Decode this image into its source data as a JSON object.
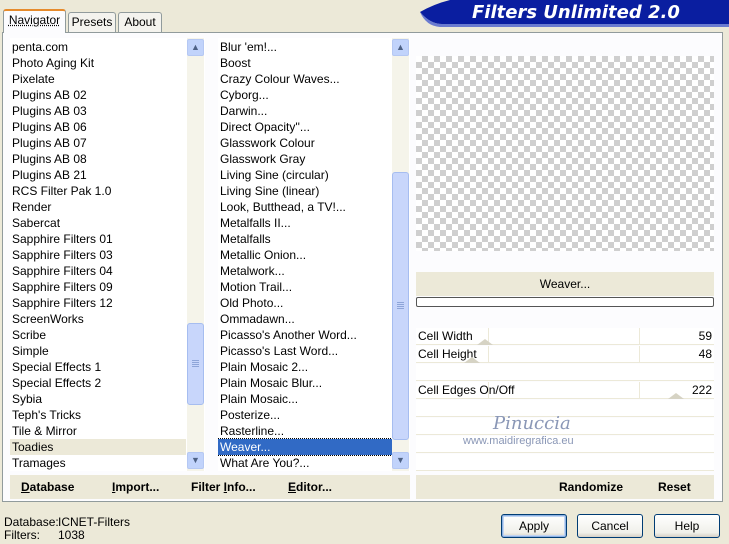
{
  "header": {
    "title": "Filters Unlimited 2.0"
  },
  "tabs": [
    {
      "label": "Navigator",
      "active": true
    },
    {
      "label": "Presets",
      "active": false
    },
    {
      "label": "About",
      "active": false
    }
  ],
  "categories": {
    "items": [
      "penta.com",
      "Photo Aging Kit",
      "Pixelate",
      "Plugins AB 02",
      "Plugins AB 03",
      "Plugins AB 06",
      "Plugins AB 07",
      "Plugins AB 08",
      "Plugins AB 21",
      "RCS Filter Pak 1.0",
      "Render",
      "Sabercat",
      "Sapphire Filters 01",
      "Sapphire Filters 03",
      "Sapphire Filters 04",
      "Sapphire Filters 09",
      "Sapphire Filters 12",
      "ScreenWorks",
      "Scribe",
      "Simple",
      "Special Effects 1",
      "Special Effects 2",
      "Sybia",
      "Teph's Tricks",
      "Tile & Mirror",
      "Toadies",
      "Tramages"
    ],
    "selected": "Toadies"
  },
  "filters": {
    "items": [
      "Blur 'em!...",
      "Boost",
      "Crazy Colour Waves...",
      "Cyborg...",
      "Darwin...",
      "Direct Opacity''...",
      "Glasswork Colour",
      "Glasswork Gray",
      "Living Sine (circular)",
      "Living Sine (linear)",
      "Look, Butthead, a TV!...",
      "Metalfalls II...",
      "Metalfalls",
      "Metallic Onion...",
      "Metalwork...",
      "Motion Trail...",
      "Old Photo...",
      "Ommadawn...",
      "Picasso's Another Word...",
      "Picasso's Last Word...",
      "Plain Mosaic 2...",
      "Plain Mosaic Blur...",
      "Plain Mosaic...",
      "Posterize...",
      "Rasterline...",
      "Weaver...",
      "What Are You?..."
    ],
    "selected": "Weaver..."
  },
  "preview": {
    "filter_name": "Weaver...",
    "progress": 0
  },
  "params": [
    {
      "label": "Cell Width",
      "value": "59"
    },
    {
      "label": "Cell Height",
      "value": "48"
    },
    {
      "label": "Cell Edges On/Off",
      "value": "222"
    }
  ],
  "watermark": {
    "name": "Pinuccia",
    "url": "www.maidiregrafica.eu"
  },
  "left_buttons": [
    {
      "key": "D",
      "rest": "atabase"
    },
    {
      "key": "I",
      "rest": "mport..."
    },
    {
      "pre": "Filter ",
      "key": "I",
      "rest": "nfo..."
    },
    {
      "key": "E",
      "rest": "ditor..."
    }
  ],
  "right_buttons": {
    "randomize": "Randomize",
    "reset": "Reset"
  },
  "footer": {
    "database_label": "Database:",
    "database_value": "ICNET-Filters",
    "filters_label": "Filters:",
    "filters_value": "1038"
  },
  "dialog_buttons": {
    "apply": "Apply",
    "cancel": "Cancel",
    "help": "Help"
  },
  "colors": {
    "selection": "#316ac5",
    "banner": "#0a1ea0",
    "panel_bg": "#ece9d8"
  }
}
